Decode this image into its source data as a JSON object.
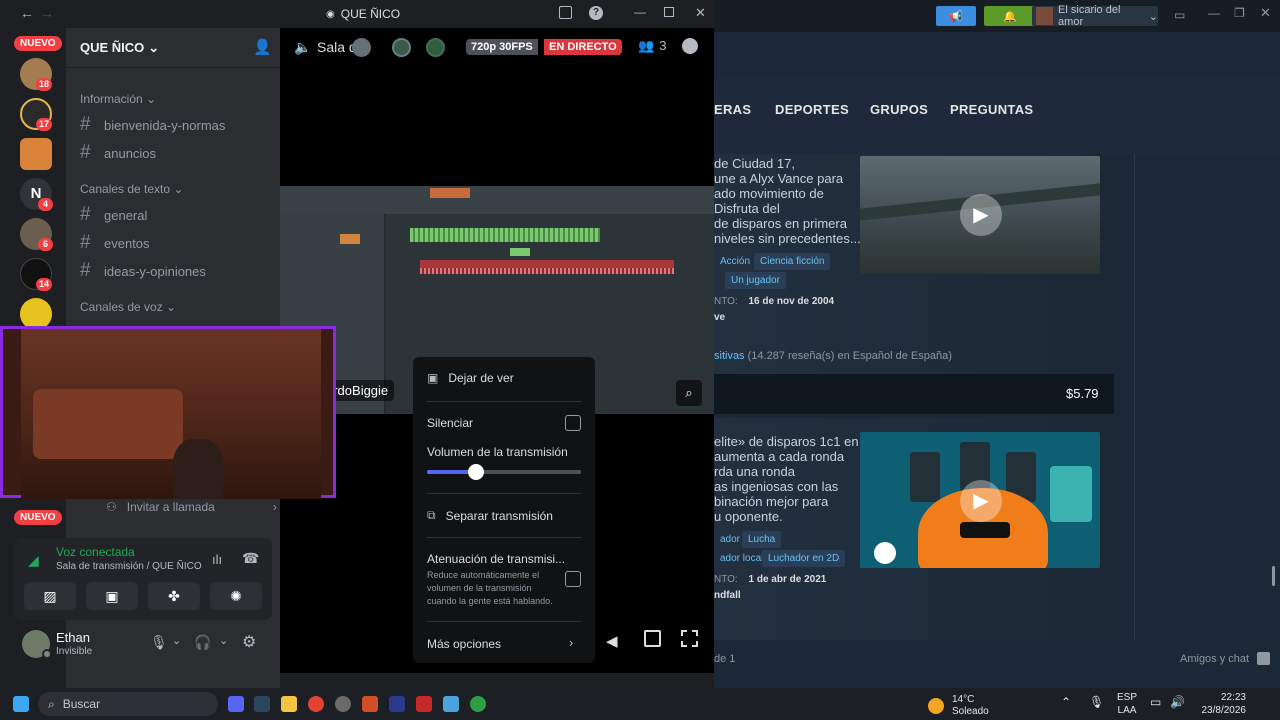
{
  "discord": {
    "window_title": "QUE ÑICO",
    "server_name": "QUE ÑICO",
    "nuevo_top": "NUEVO",
    "nuevo_bottom": "NUEVO",
    "server_badges": [
      "18",
      "17",
      "4",
      "6",
      "14"
    ],
    "server_letter": "N",
    "categories": {
      "info": "Información",
      "text": "Canales de texto",
      "voice": "Canales de voz"
    },
    "channels_info": [
      "bienvenida-y-normas",
      "anuncios"
    ],
    "channels_text": [
      "general",
      "eventos",
      "ideas-y-opiniones"
    ],
    "invite": "Invitar a llamada",
    "voice": {
      "status": "Voz conectada",
      "location": "Sala de transmisión / QUE ÑICO"
    },
    "user": {
      "name": "Ethan",
      "status": "Invisible"
    },
    "stage": {
      "room": "Sala d",
      "quality": "720p 30FPS",
      "live": "EN DIRECTO",
      "viewers": "3",
      "streamer": "ordoBiggie"
    },
    "menu": {
      "stop_watching": "Dejar de ver",
      "mute": "Silenciar",
      "volume_label": "Volumen de la transmisión",
      "volume": 0.32,
      "pop_out": "Separar transmisión",
      "attenuation": "Atenuación de transmisi...",
      "attenuation_desc": "Reduce automáticamente el volumen de la transmisión cuando la gente está hablando.",
      "more": "Más opciones"
    }
  },
  "steam": {
    "user": "El sicario del amor",
    "nav": [
      "ERAS",
      "DEPORTES",
      "GRUPOS",
      "PREGUNTAS"
    ],
    "game1": {
      "desc": "de Ciudad 17,\nune a Alyx Vance para\nado movimiento de\nDisfruta del\nde disparos en primera\nniveles sin precedentes...",
      "tags": [
        "Acción",
        "Ciencia ficción",
        "Un jugador"
      ],
      "date_label": "NTO:",
      "date": "16 de nov de 2004",
      "dev": "ve",
      "reviews": "sitivas",
      "reviews_rest": " (14.287 reseña(s) en Español de España)",
      "price": "$5.79"
    },
    "game2": {
      "desc": "elite» de disparos 1c1 en\naumenta a cada ronda\nrda una ronda\nas ingeniosas con las\nbinación mejor para\nu oponente.",
      "tags": [
        "ador",
        "Lucha",
        "ador local",
        "Luchador en 2D"
      ],
      "date_label": "NTO:",
      "date": "1 de abr de 2021",
      "dev": "ndfall"
    },
    "page": "de 1",
    "friends": "Amigos y chat"
  },
  "taskbar": {
    "search": "Buscar",
    "weather_temp": "14°C",
    "weather_text": "Soleado",
    "lang1": "ESP",
    "lang2": "LAA",
    "time": "22:23",
    "date": "23/8/2026"
  }
}
